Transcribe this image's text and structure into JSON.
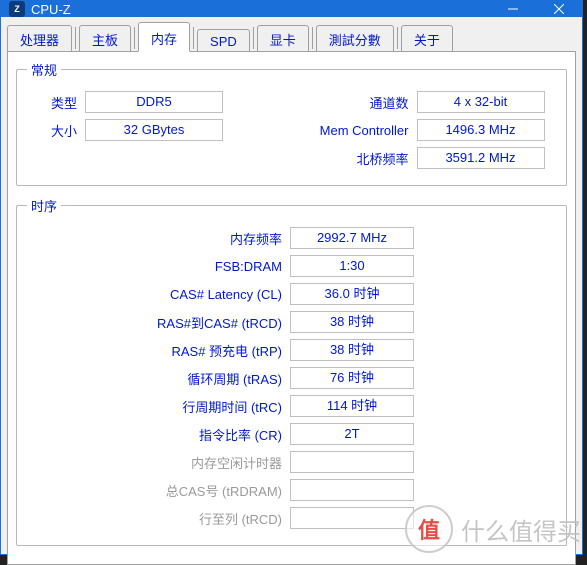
{
  "window": {
    "title": "CPU-Z",
    "icon_text": "Z"
  },
  "tabs": [
    {
      "label": "处理器"
    },
    {
      "label": "主板"
    },
    {
      "label": "内存"
    },
    {
      "label": "SPD"
    },
    {
      "label": "显卡"
    },
    {
      "label": "測試分數"
    },
    {
      "label": "关于"
    }
  ],
  "general": {
    "legend": "常规",
    "type_label": "类型",
    "type_value": "DDR5",
    "size_label": "大小",
    "size_value": "32 GBytes",
    "channels_label": "通道数",
    "channels_value": "4 x 32-bit",
    "mc_label": "Mem Controller",
    "mc_value": "1496.3 MHz",
    "nb_label": "北桥频率",
    "nb_value": "3591.2 MHz"
  },
  "timings": {
    "legend": "时序",
    "rows": [
      {
        "label": "内存频率",
        "value": "2992.7 MHz",
        "disabled": false
      },
      {
        "label": "FSB:DRAM",
        "value": "1:30",
        "disabled": false
      },
      {
        "label": "CAS# Latency (CL)",
        "value": "36.0 时钟",
        "disabled": false
      },
      {
        "label": "RAS#到CAS# (tRCD)",
        "value": "38 时钟",
        "disabled": false
      },
      {
        "label": "RAS# 预充电 (tRP)",
        "value": "38 时钟",
        "disabled": false
      },
      {
        "label": "循环周期 (tRAS)",
        "value": "76 时钟",
        "disabled": false
      },
      {
        "label": "行周期时间 (tRC)",
        "value": "114 时钟",
        "disabled": false
      },
      {
        "label": "指令比率 (CR)",
        "value": "2T",
        "disabled": false
      },
      {
        "label": "内存空闲计时器",
        "value": "",
        "disabled": true
      },
      {
        "label": "总CAS号 (tRDRAM)",
        "value": "",
        "disabled": true
      },
      {
        "label": "行至列 (tRCD)",
        "value": "",
        "disabled": true
      }
    ]
  },
  "watermark": {
    "icon": "值",
    "text": "什么值得买"
  }
}
